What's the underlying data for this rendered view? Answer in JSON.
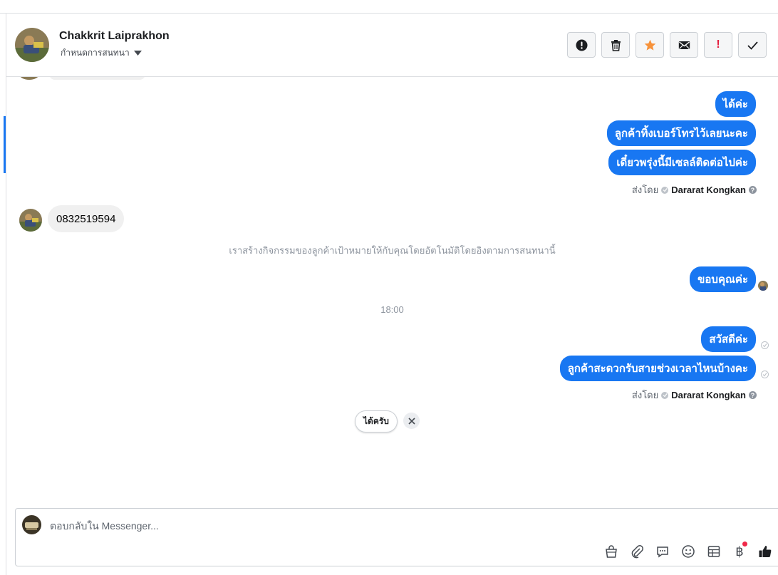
{
  "header": {
    "contact_name": "Chakkrit Laiprakhon",
    "subtitle": "กำหนดการสนทนา"
  },
  "actions": [
    {
      "name": "alert-action",
      "icon": "alert-circle-icon"
    },
    {
      "name": "delete-action",
      "icon": "trash-icon"
    },
    {
      "name": "star-action",
      "icon": "star-icon"
    },
    {
      "name": "mail-action",
      "icon": "envelope-icon"
    },
    {
      "name": "follow-up-action",
      "icon": "exclamation-icon",
      "label": "!"
    },
    {
      "name": "done-action",
      "icon": "checkmark-icon"
    }
  ],
  "thread": {
    "outgoing_group_1": [
      "ได้ค่ะ",
      "ลูกค้าทิ้งเบอร์โทรไว้เลยนะคะ",
      "เดี๋ยวพรุ่งนี้มีเซลล์ติดต่อไปค่ะ"
    ],
    "sent_by_1": {
      "prefix": "ส่งโดย",
      "name": "Dararat Kongkan"
    },
    "incoming_1": "0832519594",
    "system_note": "เราสร้างกิจกรรมของลูกค้าเป้าหมายให้กับคุณโดยอัตโนมัติโดยอิงตามการสนทนานี้",
    "outgoing_2": "ขอบคุณค่ะ",
    "time_mark": "18:00",
    "outgoing_group_3": [
      "สวัสดีค่ะ",
      "ลูกค้าสะดวกรับสายช่วงเวลาไหนบ้างคะ"
    ],
    "sent_by_2": {
      "prefix": "ส่งโดย",
      "name": "Dararat Kongkan"
    }
  },
  "quick_reply": {
    "label": "ได้ครับ"
  },
  "composer": {
    "placeholder": "ตอบกลับใน Messenger...",
    "tools": [
      "shopping-bag-icon",
      "paperclip-icon",
      "saved-reply-icon",
      "emoji-icon",
      "table-icon",
      "baht-icon",
      "thumbs-up-icon"
    ],
    "baht_symbol": "฿"
  },
  "colors": {
    "accent": "#1877f2",
    "star": "#f7923a",
    "alert_red": "#e41e3f"
  }
}
